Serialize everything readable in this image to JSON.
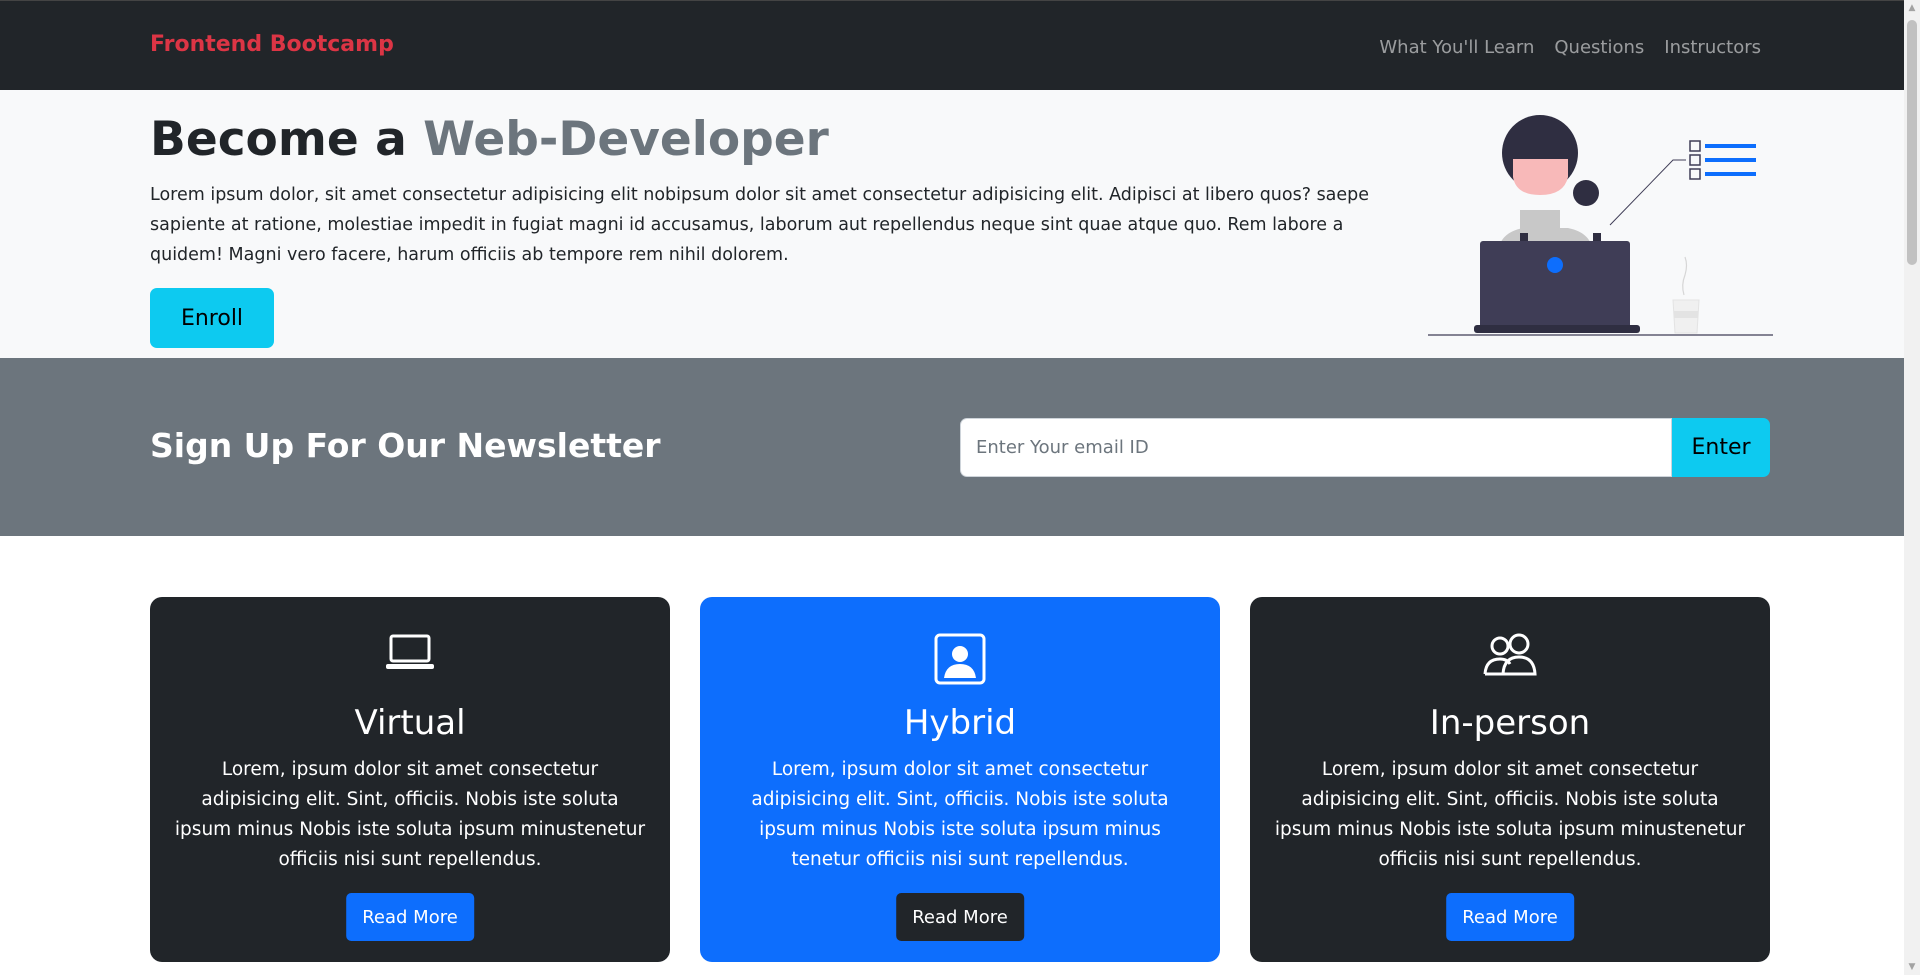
{
  "navbar": {
    "brand": "Frontend Bootcamp",
    "links": [
      "What You'll Learn",
      "Questions",
      "Instructors"
    ]
  },
  "hero": {
    "title_plain": "Become a ",
    "title_accent": "Web-Developer",
    "text": "Lorem ipsum dolor, sit amet consectetur adipisicing elit nobipsum dolor sit amet consectetur adipisicing elit. Adipisci at libero quos? saepe sapiente at ratione, molestiae impedit in fugiat magni id accusamus, laborum aut repellendus neque sint quae atque quo. Rem labore a quidem! Magni vero facere, harum officiis ab tempore rem nihil dolorem.",
    "enroll_label": "Enroll"
  },
  "newsletter": {
    "title": "Sign Up For Our Newsletter",
    "email_placeholder": "Enter Your email ID",
    "email_value": "",
    "enter_label": "Enter"
  },
  "cards": [
    {
      "icon": "laptop-icon",
      "title": "Virtual",
      "text": "Lorem, ipsum dolor sit amet consectetur adipisicing elit. Sint, officiis. Nobis iste soluta ipsum minus Nobis iste soluta ipsum minustenetur officiis nisi sunt repellendus.",
      "button_label": "Read More"
    },
    {
      "icon": "person-square-icon",
      "title": "Hybrid",
      "text": "Lorem, ipsum dolor sit amet consectetur adipisicing elit. Sint, officiis. Nobis iste soluta ipsum minus Nobis iste soluta ipsum minus tenetur officiis nisi sunt repellendus.",
      "button_label": "Read More"
    },
    {
      "icon": "people-icon",
      "title": "In-person",
      "text": "Lorem, ipsum dolor sit amet consectetur adipisicing elit. Sint, officiis. Nobis iste soluta ipsum minus Nobis iste soluta ipsum minustenetur officiis nisi sunt repellendus.",
      "button_label": "Read More"
    }
  ],
  "colors": {
    "navbar_bg": "#212529",
    "brand": "#dc3545",
    "hero_bg": "#f8f9fa",
    "newsletter_bg": "#6c757d",
    "accent_cyan": "#0dcaf0",
    "primary_blue": "#0d6efd",
    "dark": "#212529"
  }
}
